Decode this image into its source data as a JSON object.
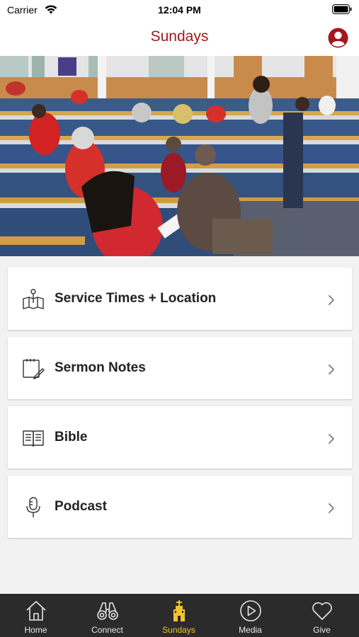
{
  "status_bar": {
    "carrier": "Carrier",
    "time": "12:04 PM",
    "icons": [
      "wifi-icon",
      "battery-icon"
    ]
  },
  "header": {
    "title": "Sundays",
    "title_color": "#a3171d",
    "profile_icon": "person-circle-icon"
  },
  "hero": {
    "image_icon": "congregation-photo"
  },
  "menu": {
    "items": [
      {
        "label": "Service Times + Location",
        "icon": "map-pin-icon"
      },
      {
        "label": "Sermon Notes",
        "icon": "notepad-pencil-icon"
      },
      {
        "label": "Bible",
        "icon": "open-book-icon"
      },
      {
        "label": "Podcast",
        "icon": "microphone-icon"
      }
    ]
  },
  "tab_bar": {
    "active": "Sundays",
    "active_color": "#f2c230",
    "tabs": [
      {
        "label": "Home",
        "icon": "home-icon"
      },
      {
        "label": "Connect",
        "icon": "binoculars-icon"
      },
      {
        "label": "Sundays",
        "icon": "church-icon"
      },
      {
        "label": "Media",
        "icon": "play-circle-icon"
      },
      {
        "label": "Give",
        "icon": "heart-icon"
      }
    ]
  }
}
